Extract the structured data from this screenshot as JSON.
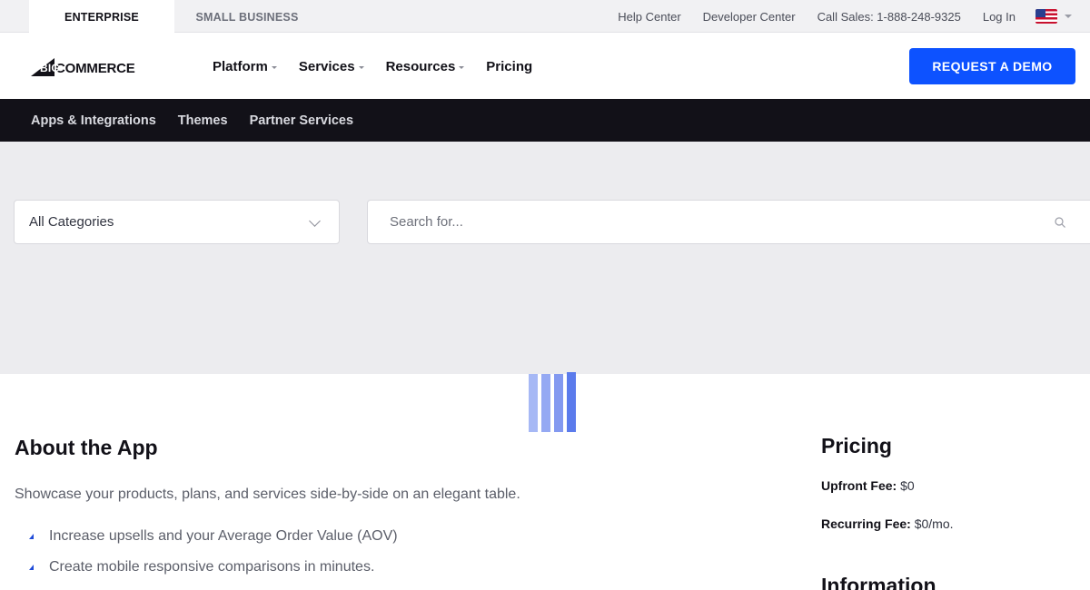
{
  "topbar": {
    "segments": [
      "ENTERPRISE",
      "SMALL BUSINESS"
    ],
    "links": [
      "Help Center",
      "Developer Center",
      "Call Sales: 1-888-248-9325",
      "Log In"
    ],
    "flag_icon": "us-flag-icon"
  },
  "header": {
    "logo": {
      "big": "BIG",
      "commerce": "COMMERCE"
    },
    "nav": [
      {
        "label": "Platform",
        "dropdown": true
      },
      {
        "label": "Services",
        "dropdown": true
      },
      {
        "label": "Resources",
        "dropdown": true
      },
      {
        "label": "Pricing",
        "dropdown": false
      }
    ],
    "cta_label": "REQUEST A DEMO"
  },
  "subnav": {
    "items": [
      "Apps & Integrations",
      "Themes",
      "Partner Services"
    ]
  },
  "search": {
    "category_value": "All Categories",
    "placeholder": "Search for..."
  },
  "about": {
    "title": "About the App",
    "description": "Showcase your products, plans, and services side-by-side on an elegant table.",
    "bullets": [
      "Increase upsells and your Average Order Value (AOV)",
      "Create mobile responsive comparisons in minutes."
    ]
  },
  "pricing": {
    "title": "Pricing",
    "upfront_label": "Upfront Fee:",
    "upfront_value": "$0",
    "recurring_label": "Recurring Fee:",
    "recurring_value": "$0/mo."
  },
  "information": {
    "title": "Information"
  },
  "colors": {
    "accent": "#0d52ff",
    "subnav_bg": "#121118",
    "loader": [
      "#a6b8f5",
      "#95a9f3",
      "#8399f0",
      "#5b7bec"
    ]
  }
}
